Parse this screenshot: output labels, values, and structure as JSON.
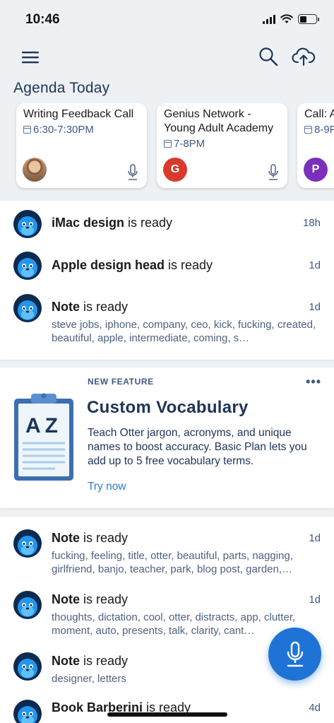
{
  "status_bar": {
    "time": "10:46"
  },
  "agenda": {
    "title": "Agenda Today",
    "cards": [
      {
        "title": "Writing Feedback Call",
        "time": "6:30-7:30PM",
        "avatar_letter": "",
        "avatar_color": ""
      },
      {
        "title": "Genius Network - Young Adult Academy",
        "time": "7-8PM",
        "avatar_letter": "G",
        "avatar_color": "#d93a2b"
      },
      {
        "title": "Call: A",
        "time": "8-9P",
        "avatar_letter": "P",
        "avatar_color": "#7b2fbf"
      }
    ]
  },
  "feed_top": [
    {
      "name": "iMac design",
      "suffix": " is ready",
      "time": "18h"
    },
    {
      "name": "Apple design head",
      "suffix": " is ready",
      "time": "1d"
    },
    {
      "name": "Note",
      "suffix": " is ready",
      "time": "1d",
      "keywords": "steve jobs, iphone, company, ceo, kick, fucking, created, beautiful, apple, intermediate, coming, s…"
    }
  ],
  "promo": {
    "eyebrow": "NEW FEATURE",
    "more": "•••",
    "title": "Custom Vocabulary",
    "body": "Teach Otter jargon, acronyms, and unique names to boost accuracy. Basic Plan lets you add up to 5 free vocabulary terms.",
    "link": "Try now",
    "art_letters": "AZ"
  },
  "feed_bottom": [
    {
      "name": "Note",
      "suffix": " is ready",
      "time": "1d",
      "keywords": "fucking, feeling, title, otter, beautiful, parts, nagging, girlfriend, banjo, teacher, park, blog post, garden,…"
    },
    {
      "name": "Note",
      "suffix": " is ready",
      "time": "1d",
      "keywords": "thoughts, dictation, cool, otter, distracts, app, clutter, moment, auto, presents, talk, clarity, cant…"
    },
    {
      "name": "Note",
      "suffix": " is ready",
      "time": "",
      "keywords": "designer, letters"
    },
    {
      "name": "Book Barberini",
      "suffix": " is ready",
      "time": "4d"
    }
  ],
  "colors": {
    "accent": "#1f73d6",
    "navy": "#1d3557",
    "muted": "#3d5a80",
    "otter_blue": "#1e88e5"
  }
}
